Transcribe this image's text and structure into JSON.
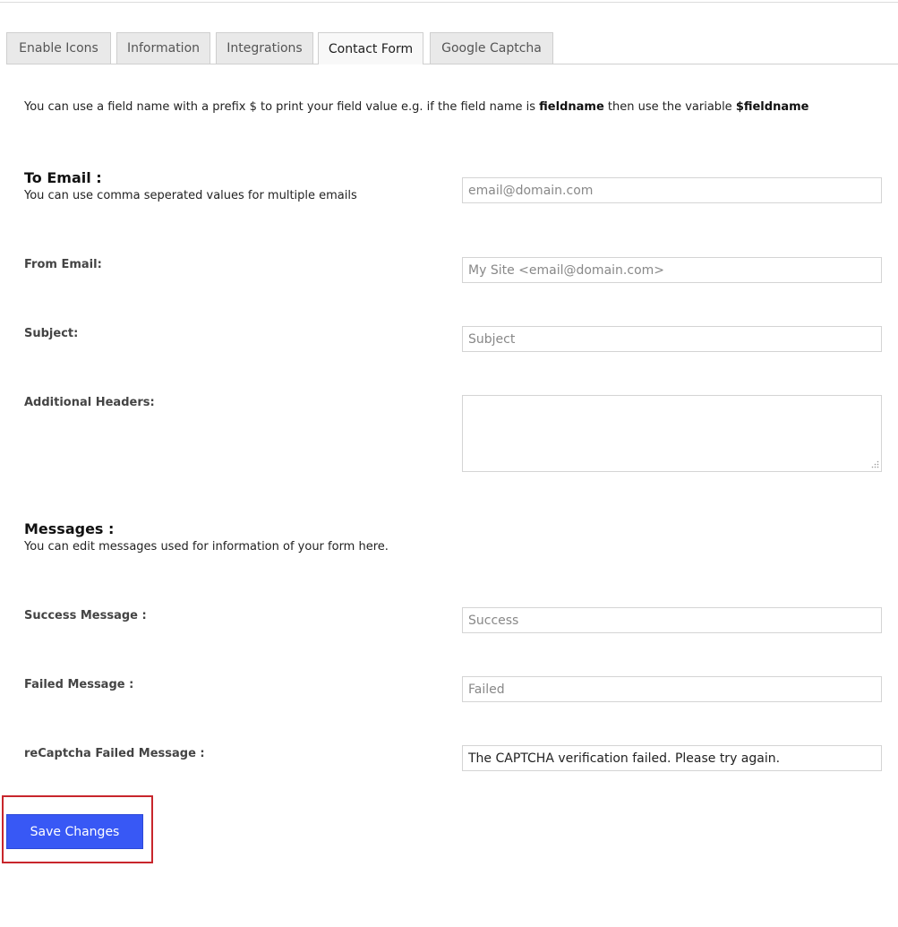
{
  "tabs": [
    {
      "label": "Enable Icons"
    },
    {
      "label": "Information"
    },
    {
      "label": "Integrations"
    },
    {
      "label": "Contact Form",
      "active": true
    },
    {
      "label": "Google Captcha"
    }
  ],
  "intro": {
    "prefix": "You can use a field name with a prefix $ to print your field value e.g. if the field name is ",
    "fieldname": "fieldname",
    "middle": " then use the variable ",
    "variable": "$fieldname"
  },
  "to_email": {
    "title": "To Email :",
    "description": "You can use comma seperated values for multiple emails",
    "placeholder": "email@domain.com",
    "value": ""
  },
  "from_email": {
    "label": "From Email:",
    "placeholder": "My Site <email@domain.com>",
    "value": ""
  },
  "subject": {
    "label": "Subject:",
    "placeholder": "Subject",
    "value": ""
  },
  "additional_headers": {
    "label": "Additional Headers:",
    "value": ""
  },
  "messages": {
    "title": "Messages :",
    "description": "You can edit messages used for information of your form here."
  },
  "success_message": {
    "label": "Success Message :",
    "placeholder": "Success",
    "value": ""
  },
  "failed_message": {
    "label": "Failed Message :",
    "placeholder": "Failed",
    "value": ""
  },
  "recaptcha_failed_message": {
    "label": "reCaptcha Failed Message :",
    "value": "The CAPTCHA verification failed. Please try again."
  },
  "save_button": {
    "label": "Save Changes"
  },
  "colors": {
    "button": "#3858f5",
    "highlight": "#c8262c"
  }
}
